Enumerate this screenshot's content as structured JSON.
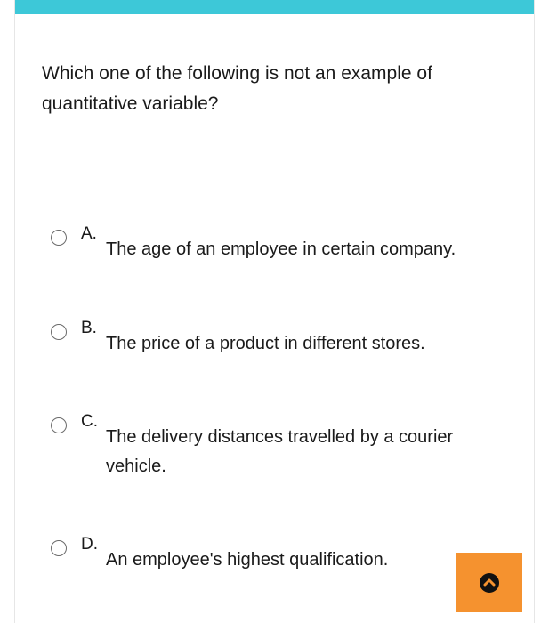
{
  "question": {
    "text": "Which one of the following is not an example of quantitative variable?"
  },
  "options": [
    {
      "letter": "A.",
      "text": "The age of an employee in certain company."
    },
    {
      "letter": "B.",
      "text": "The price of a product in different stores."
    },
    {
      "letter": "C.",
      "text": "The delivery distances travelled by a courier vehicle."
    },
    {
      "letter": "D.",
      "text": "An employee's highest qualification."
    }
  ],
  "scroll_button": {
    "icon": "chevron-up-icon"
  },
  "colors": {
    "top_bar": "#3dc8d8",
    "scroll_button": "#f5922f"
  }
}
